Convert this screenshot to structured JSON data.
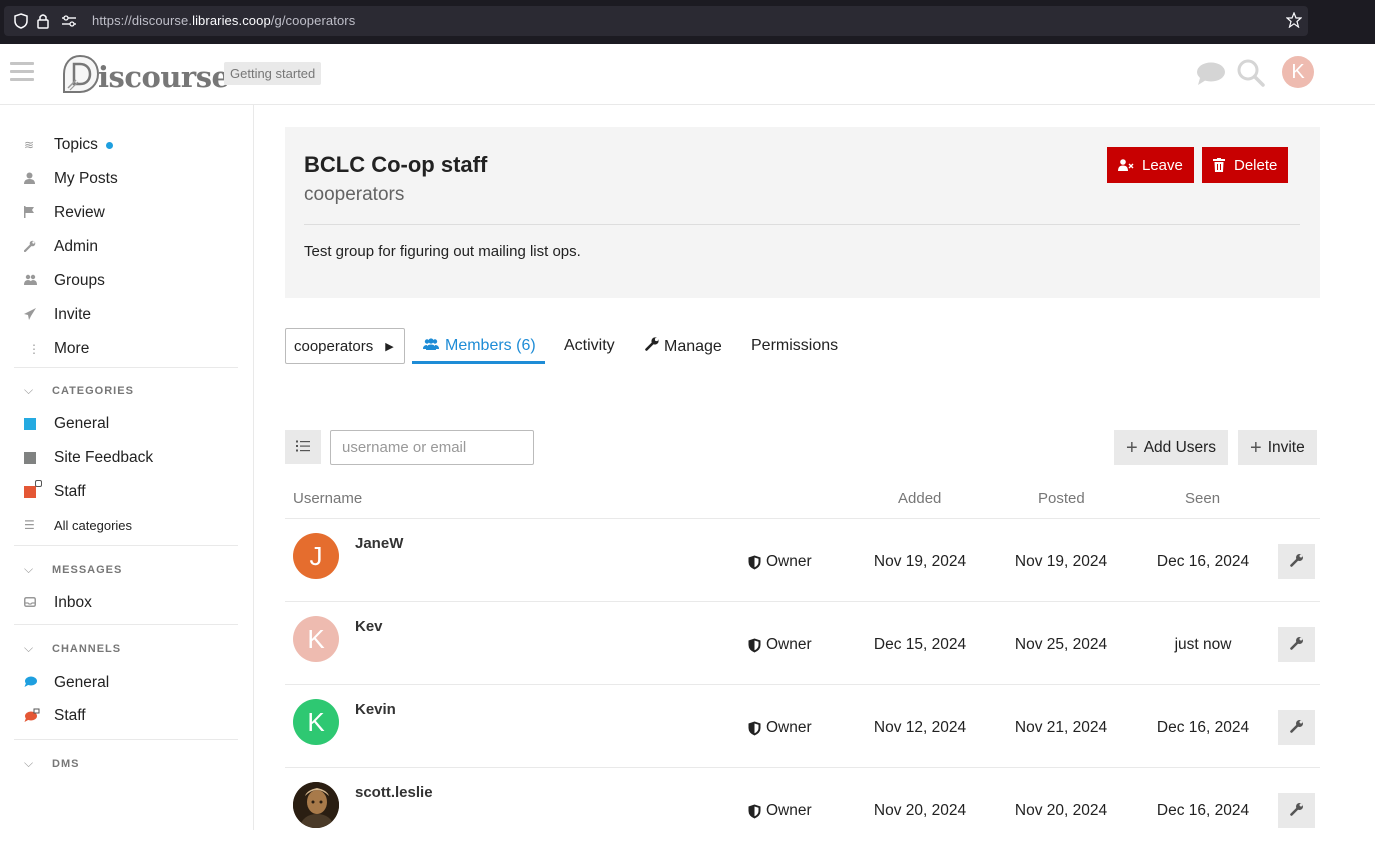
{
  "browser": {
    "url_prefix": "https://discourse.",
    "url_domain": "libraries.coop",
    "url_suffix": "/g/cooperators"
  },
  "header": {
    "logo_text": "iscourse",
    "getting_started": "Getting started",
    "avatar_letter": "K",
    "avatar_color": "#eebbb0"
  },
  "sidebar": {
    "items": [
      {
        "label": "Topics",
        "icon": "layers-icon"
      },
      {
        "label": "My Posts",
        "icon": "user-icon"
      },
      {
        "label": "Review",
        "icon": "flag-icon"
      },
      {
        "label": "Admin",
        "icon": "wrench-icon"
      },
      {
        "label": "Groups",
        "icon": "users-icon"
      },
      {
        "label": "Invite",
        "icon": "paper-plane-icon"
      },
      {
        "label": "More",
        "icon": "ellipsis-vertical-icon"
      }
    ],
    "categories_title": "CATEGORIES",
    "categories": [
      {
        "label": "General",
        "color": "#25aae1"
      },
      {
        "label": "Site Feedback",
        "color": "#808281"
      },
      {
        "label": "Staff",
        "color": "#e45735"
      }
    ],
    "all_categories": "All categories",
    "messages_title": "MESSAGES",
    "inbox": "Inbox",
    "channels_title": "CHANNELS",
    "channels": [
      {
        "label": "General",
        "color": "#1e9fdf"
      },
      {
        "label": "Staff",
        "color": "#e45735"
      }
    ],
    "dms_title": "DMS"
  },
  "group": {
    "name": "BCLC Co-op staff",
    "slug": "cooperators",
    "description": "Test group for figuring out mailing list ops.",
    "leave_label": "Leave",
    "delete_label": "Delete"
  },
  "nav": {
    "select_label": "cooperators",
    "tabs": [
      "Members (6)",
      "Activity",
      "Manage",
      "Permissions"
    ]
  },
  "toolbar": {
    "filter_placeholder": "username or email",
    "add_users_label": "Add Users",
    "invite_label": "Invite"
  },
  "table": {
    "headers": [
      "Username",
      "Added",
      "Posted",
      "Seen"
    ],
    "rows": [
      {
        "username": "JaneW",
        "letter": "J",
        "avatar_color": "#e56d2e",
        "role": "Owner",
        "added": "Nov 19, 2024",
        "posted": "Nov 19, 2024",
        "seen": "Dec 16, 2024"
      },
      {
        "username": "Kev",
        "letter": "K",
        "avatar_color": "#eebbb0",
        "role": "Owner",
        "added": "Dec 15, 2024",
        "posted": "Nov 25, 2024",
        "seen": "just now"
      },
      {
        "username": "Kevin",
        "letter": "K",
        "avatar_color": "#2ec872",
        "role": "Owner",
        "added": "Nov 12, 2024",
        "posted": "Nov 21, 2024",
        "seen": "Dec 16, 2024"
      },
      {
        "username": "scott.leslie",
        "letter": "",
        "avatar_color": "#3a2a1a",
        "role": "Owner",
        "added": "Nov 20, 2024",
        "posted": "Nov 20, 2024",
        "seen": "Dec 16, 2024"
      }
    ]
  }
}
